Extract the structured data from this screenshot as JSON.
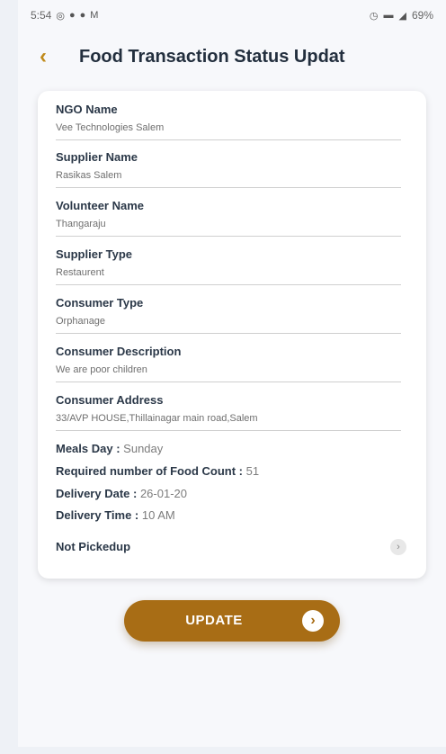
{
  "status_bar": {
    "time": "5:54",
    "left_icons": [
      "whatsapp-icon",
      "notification-icon",
      "notification-icon",
      "gmail-icon"
    ],
    "right_icons": [
      "alarm-icon",
      "volte-icon",
      "signal-icon"
    ],
    "battery": "69%"
  },
  "header": {
    "back_icon": "chevron-left-icon",
    "title": "Food Transaction Status Updat"
  },
  "fields": [
    {
      "label": "NGO Name",
      "value": "Vee Technologies Salem"
    },
    {
      "label": "Supplier Name",
      "value": "Rasikas Salem"
    },
    {
      "label": "Volunteer Name",
      "value": "Thangaraju"
    },
    {
      "label": "Supplier Type",
      "value": "Restaurent"
    },
    {
      "label": "Consumer Type",
      "value": "Orphanage"
    },
    {
      "label": "Consumer Description",
      "value": "We are poor children"
    },
    {
      "label": "Consumer Address",
      "value": "33/AVP HOUSE,Thillainagar main road,Salem"
    }
  ],
  "details": {
    "meals_day_label": "Meals Day :",
    "meals_day_value": "Sunday",
    "food_count_label": "Required number of Food Count :",
    "food_count_value": "51",
    "delivery_date_label": "Delivery Date :",
    "delivery_date_value": "26-01-20",
    "delivery_time_label": "Delivery Time :",
    "delivery_time_value": "10 AM"
  },
  "status": {
    "label": "Not Pickedup",
    "icon": "chevron-right-icon"
  },
  "update_button": {
    "label": "UPDATE",
    "icon": "chevron-right-icon"
  },
  "colors": {
    "accent": "#a86d15",
    "back_arrow": "#c08a1a",
    "title": "#232f3e"
  }
}
